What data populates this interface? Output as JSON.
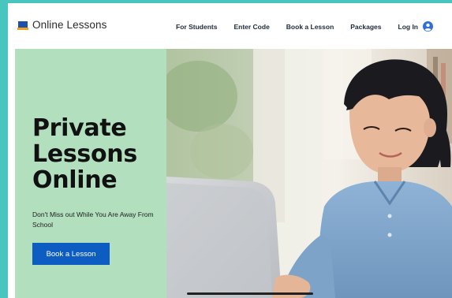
{
  "header": {
    "brand": "Online Lessons",
    "logo_icon": "laptop-icon",
    "nav": [
      {
        "label": "For Students"
      },
      {
        "label": "Enter Code"
      },
      {
        "label": "Book a Lesson"
      },
      {
        "label": "Packages"
      }
    ],
    "login_label": "Log In",
    "user_icon": "user-circle-icon"
  },
  "hero": {
    "headline_lines": [
      "Private",
      "Lessons",
      "Online"
    ],
    "subtext": "Don't Miss out While You Are Away From School",
    "cta_label": "Book a Lesson"
  },
  "colors": {
    "page_background": "#46c6bf",
    "panel": "#b2dfbe",
    "cta": "#0d5cc2",
    "logo_blue": "#1f4fae",
    "logo_orange": "#f0a21c"
  }
}
